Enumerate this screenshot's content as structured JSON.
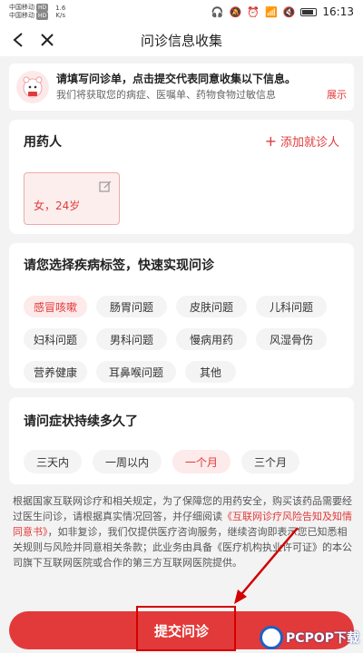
{
  "status_bar": {
    "carrier1": "中国移动",
    "carrier2": "中国移动",
    "tag": "HD",
    "speed_value": "1.6",
    "speed_unit": "K/s",
    "battery_label": "",
    "time": "16:13"
  },
  "nav": {
    "back_glyph": "<",
    "close_glyph": "✕",
    "title": "问诊信息收集"
  },
  "notice": {
    "line1": "请填写问诊单，点击提交代表同意收集以下信息。",
    "line2": "我们将获取您的病症、医嘱单、药物食物过敏信息",
    "expand": "展示"
  },
  "patient": {
    "title": "用药人",
    "add_label": "添加就诊人",
    "chip_info": "女，24岁"
  },
  "disease": {
    "title": "请您选择疾病标签，快速实现问诊",
    "rows": [
      [
        {
          "label": "感冒咳嗽",
          "active": true
        },
        {
          "label": "肠胃问题",
          "active": false
        },
        {
          "label": "皮肤问题",
          "active": false
        },
        {
          "label": "儿科问题",
          "active": false
        }
      ],
      [
        {
          "label": "妇科问题",
          "active": false
        },
        {
          "label": "男科问题",
          "active": false
        },
        {
          "label": "慢病用药",
          "active": false
        },
        {
          "label": "风湿骨伤",
          "active": false
        }
      ],
      [
        {
          "label": "营养健康",
          "active": false
        },
        {
          "label": "耳鼻喉问题",
          "active": false
        },
        {
          "label": "其他",
          "active": false
        }
      ]
    ]
  },
  "duration": {
    "title": "请问症状持续多久了",
    "options": [
      {
        "label": "三天内",
        "active": false
      },
      {
        "label": "一周以内",
        "active": false
      },
      {
        "label": "一个月",
        "active": true
      },
      {
        "label": "三个月",
        "active": false
      }
    ]
  },
  "disclaimer": {
    "part1": "根据国家互联网诊疗和相关规定，为了保障您的用药安全，购买该药品需要经过医生问诊，请根据真实情况回答，并仔细阅读",
    "link1": "《互联网诊疗风险告知及知情同意书》",
    "part2": "，如非复诊，我们仅提供医疗咨询服务，继续咨询即表示您已知悉相关规则与风险并同意相关条款；此业务由具备《医疗机构执业许可证》的本公司旗下互联网医院或合作的第三方互联网医院提供。"
  },
  "submit": {
    "label": "提交问诊"
  },
  "watermark": {
    "text": "PCPOP下载"
  },
  "colors": {
    "accent": "#e23a3a",
    "active_bg": "#fdeaea",
    "highlight": "#d20000"
  }
}
